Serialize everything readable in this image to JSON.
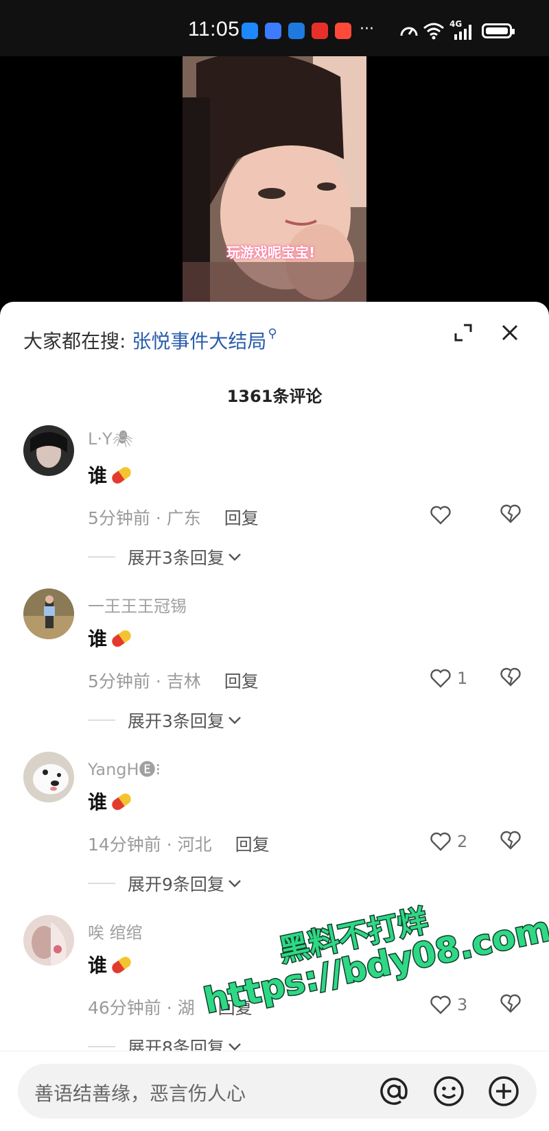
{
  "status_bar": {
    "time": "11:05",
    "notification_icons": [
      {
        "name": "message-app-icon",
        "color": "#1e88ff"
      },
      {
        "name": "signal-app-icon",
        "color": "#3d7cff"
      },
      {
        "name": "browser-app-icon",
        "color": "#1f7ae0"
      },
      {
        "name": "news-app-icon",
        "color": "#e8302a"
      },
      {
        "name": "shopping-app-icon",
        "color": "#ff4a3a"
      }
    ],
    "more": "···",
    "network": "4G"
  },
  "video": {
    "caption": "玩游戏呢宝宝!"
  },
  "sheet": {
    "search_prefix": "大家都在搜:",
    "search_keyword": "张悦事件大结局",
    "comment_count": "1361条评论"
  },
  "comments": [
    {
      "username": "L·Y🕷",
      "text": "谁",
      "time": "5分钟前",
      "location": "广东",
      "reply": "回复",
      "likes": "",
      "expand": "展开3条回复"
    },
    {
      "username": "一王王王冠锡",
      "text": "谁",
      "time": "5分钟前",
      "location": "吉林",
      "reply": "回复",
      "likes": "1",
      "expand": "展开3条回复"
    },
    {
      "username": "YangH🅔⁝",
      "text": "谁",
      "time": "14分钟前",
      "location": "河北",
      "reply": "回复",
      "likes": "2",
      "expand": "展开9条回复"
    },
    {
      "username": "唉 绾绾",
      "text": "谁",
      "time": "46分钟前",
      "location": "湖",
      "reply": "回复",
      "likes": "3",
      "expand": "展开8条回复"
    }
  ],
  "input": {
    "placeholder": "善语结善缘，恶言伤人心"
  },
  "watermark": {
    "line1": "黑料不打烊",
    "line2": "https://bdy08.com"
  },
  "colors": {
    "link": "#2a5caa",
    "watermark_fill": "#2fd884"
  }
}
